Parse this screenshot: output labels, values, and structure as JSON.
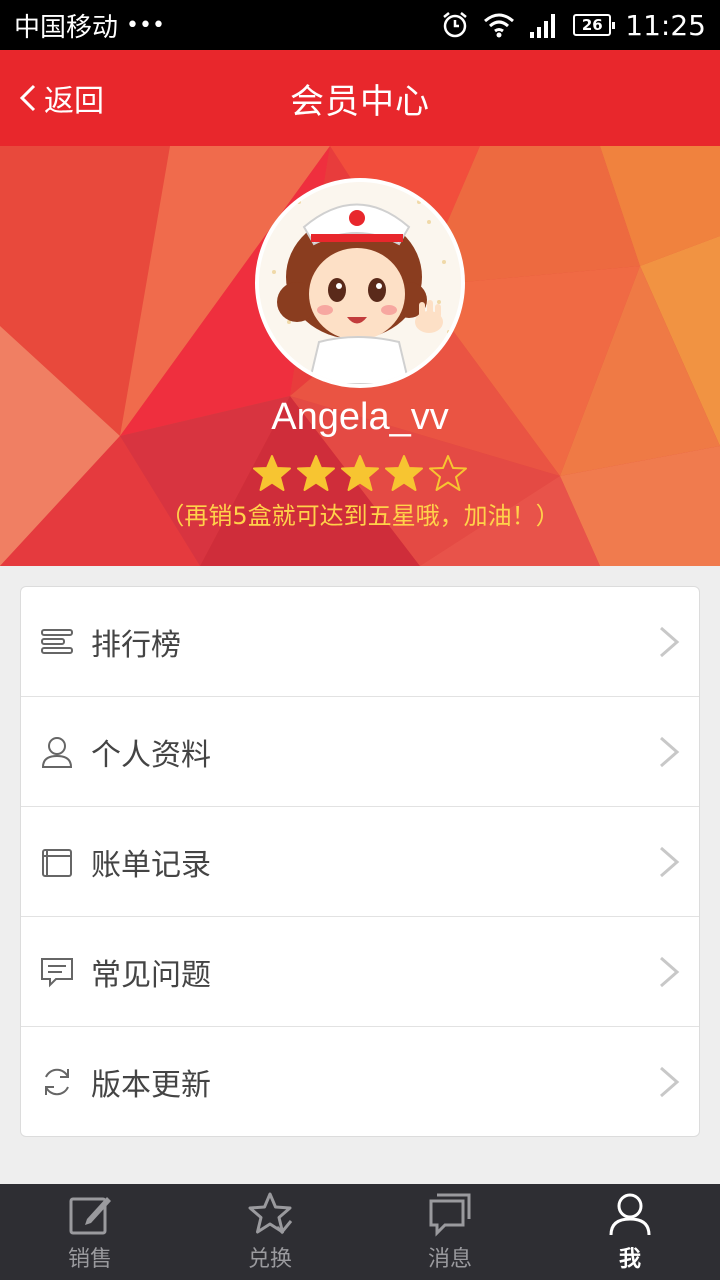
{
  "status_bar": {
    "carrier": "中国移动",
    "dots": "•••",
    "battery": "26",
    "time": "11:25"
  },
  "header": {
    "back_label": "返回",
    "title": "会员中心"
  },
  "profile": {
    "username": "Angela_vv",
    "rating": 4,
    "max_rating": 5,
    "hint": "（再销5盒就可达到五星哦，加油！）"
  },
  "menu": {
    "items": [
      {
        "label": "排行榜",
        "icon": "ranking-icon"
      },
      {
        "label": "个人资料",
        "icon": "user-profile-icon"
      },
      {
        "label": "账单记录",
        "icon": "bill-icon"
      },
      {
        "label": "常见问题",
        "icon": "faq-icon"
      },
      {
        "label": "版本更新",
        "icon": "refresh-icon"
      }
    ]
  },
  "tabbar": {
    "tabs": [
      {
        "label": "销售",
        "icon": "edit-icon",
        "active": false
      },
      {
        "label": "兑换",
        "icon": "star-check-icon",
        "active": false
      },
      {
        "label": "消息",
        "icon": "message-icon",
        "active": false
      },
      {
        "label": "我",
        "icon": "person-icon",
        "active": true
      }
    ]
  },
  "colors": {
    "brand_red": "#e8272c",
    "star_gold": "#f7c531",
    "hint_yellow": "#ffd24a",
    "tabbar_bg": "#2e2e33"
  }
}
